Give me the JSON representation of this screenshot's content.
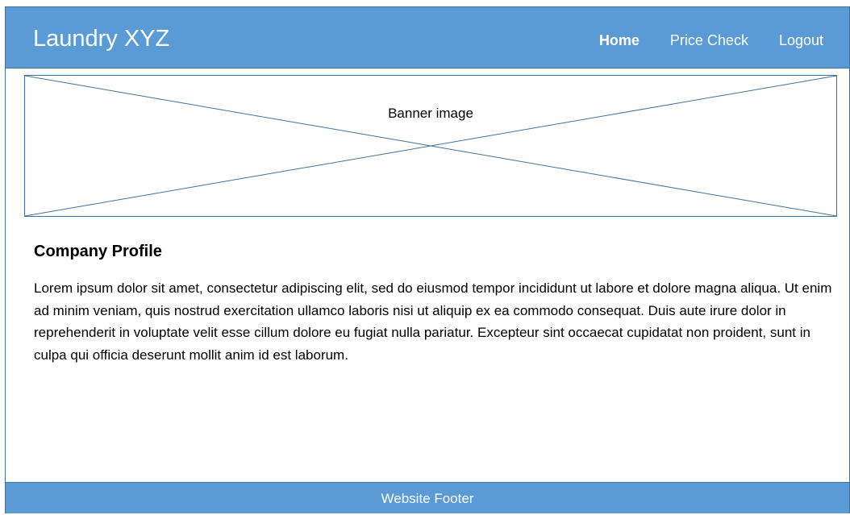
{
  "header": {
    "brand": "Laundry XYZ",
    "nav": [
      {
        "label": "Home",
        "active": true
      },
      {
        "label": "Price Check",
        "active": false
      },
      {
        "label": "Logout",
        "active": false
      }
    ]
  },
  "banner": {
    "label": "Banner image"
  },
  "profile": {
    "title": "Company Profile",
    "text": "Lorem ipsum dolor sit amet, consectetur adipiscing elit, sed do eiusmod tempor incididunt ut labore et dolore magna aliqua. Ut enim ad minim veniam, quis nostrud exercitation ullamco laboris nisi ut aliquip ex ea commodo consequat. Duis aute irure dolor in reprehenderit in voluptate velit esse cillum dolore eu fugiat nulla pariatur. Excepteur sint occaecat cupidatat non proident, sunt in culpa qui officia deserunt mollit anim id est laborum."
  },
  "footer": {
    "label": "Website Footer"
  },
  "colors": {
    "header_bg": "#5b9bd5",
    "border": "#41719c",
    "text": "#000000",
    "header_text": "#ffffff"
  }
}
